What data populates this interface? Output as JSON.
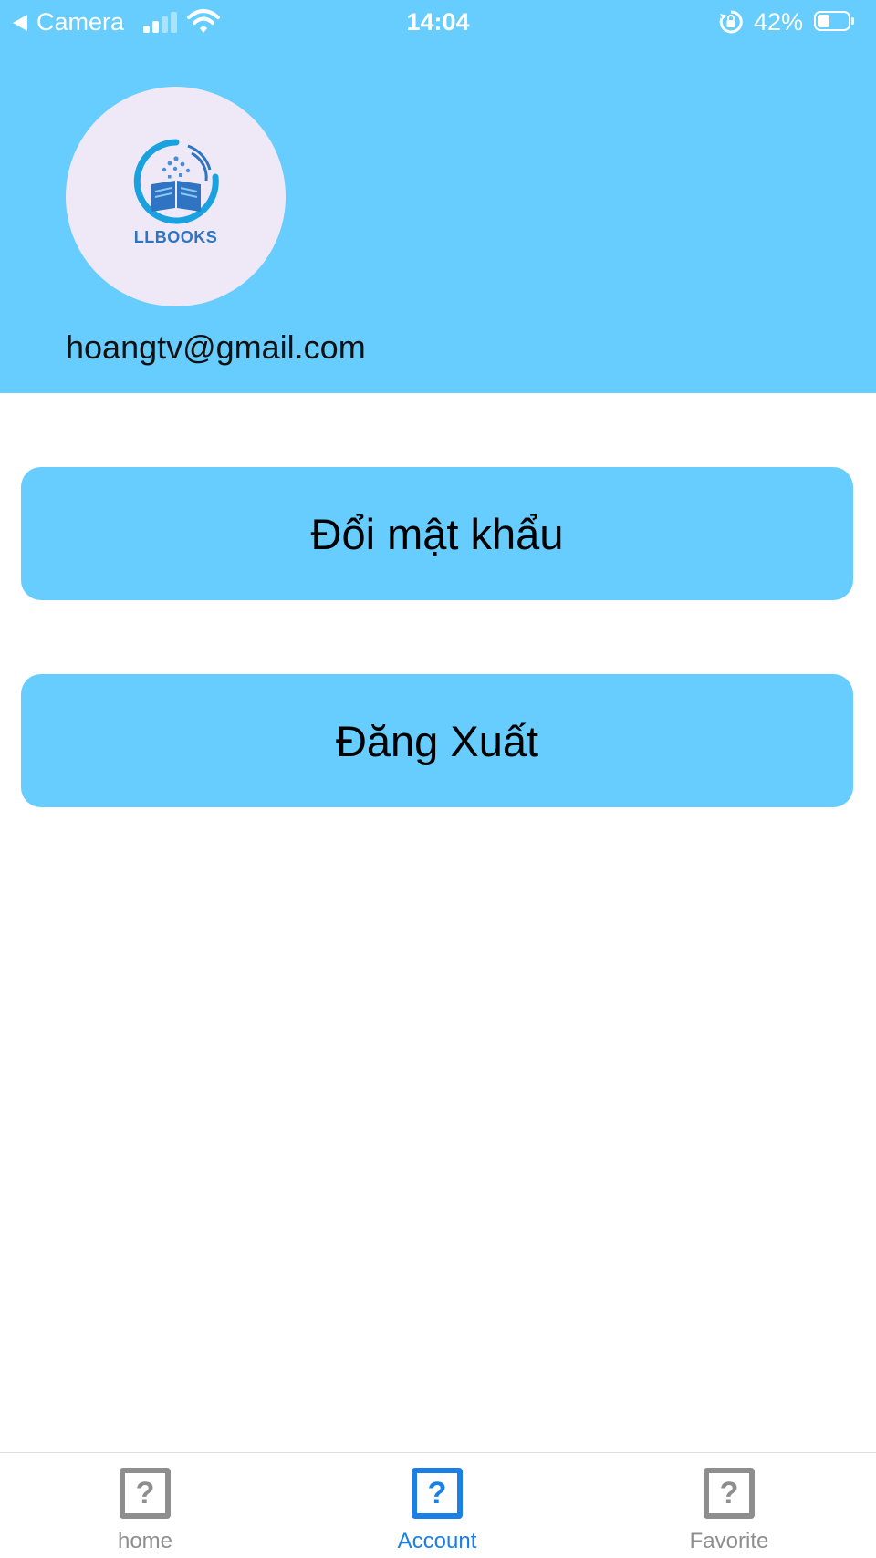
{
  "status_bar": {
    "back_label": "Camera",
    "time": "14:04",
    "battery_percent": "42%",
    "battery_level": 0.42,
    "signal_bars_active": 2,
    "signal_bars_total": 4
  },
  "profile": {
    "logo_text": "LLBOOKS",
    "email": "hoangtv@gmail.com"
  },
  "actions": {
    "change_password_label": "Đổi mật khẩu",
    "logout_label": "Đăng Xuất"
  },
  "tabbar": {
    "active": "Account",
    "tabs": [
      {
        "label": "home",
        "icon": "question-square-icon"
      },
      {
        "label": "Account",
        "icon": "question-square-icon"
      },
      {
        "label": "Favorite",
        "icon": "question-square-icon"
      }
    ]
  },
  "colors": {
    "header_bg": "#66cdfe",
    "button_bg": "#66cdfe",
    "tab_active": "#1a7fe6",
    "tab_inactive": "#8e8e8e",
    "logo_blue": "#2e74c2"
  }
}
